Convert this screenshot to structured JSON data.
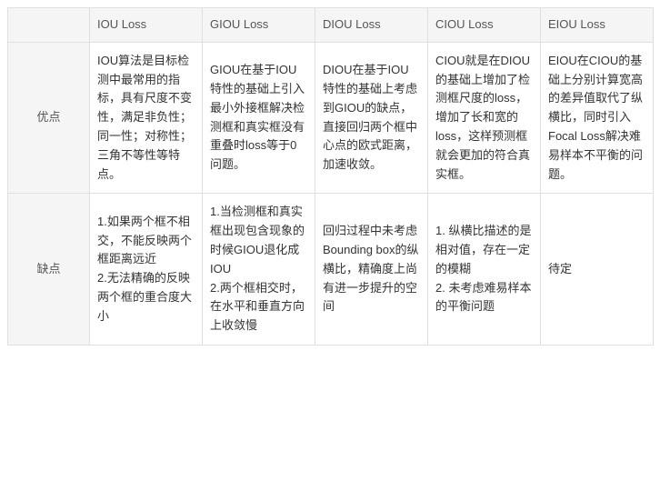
{
  "headers": {
    "empty": "",
    "iou": "IOU Loss",
    "giou": "GIOU Loss",
    "diou": "DIOU Loss",
    "ciou": "CIOU Loss",
    "eiou": "EIOU Loss"
  },
  "rows": {
    "advantages": {
      "label": "优点",
      "iou": "IOU算法是目标检测中最常用的指标，具有尺度不变性，满足非负性；同一性；对称性；三角不等性等特点。",
      "giou": "GIOU在基于IOU特性的基础上引入最小外接框解决检测框和真实框没有重叠时loss等于0问题。",
      "diou": "DIOU在基于IOU特性的基础上考虑到GIOU的缺点，直接回归两个框中心点的欧式距离，加速收敛。",
      "ciou": "CIOU就是在DIOU的基础上增加了检测框尺度的loss，增加了长和宽的loss，这样预测框就会更加的符合真实框。",
      "eiou": "EIOU在CIOU的基础上分别计算宽高的差异值取代了纵横比，同时引入Focal Loss解决难易样本不平衡的问题。"
    },
    "disadvantages": {
      "label": "缺点",
      "iou": "1.如果两个框不相交，不能反映两个框距离远近\n2.无法精确的反映两个框的重合度大小",
      "giou": "1.当检测框和真实框出现包含现象的时候GIOU退化成IOU\n2.两个框相交时，在水平和垂直方向上收敛慢",
      "diou": "回归过程中未考虑Bounding box的纵横比，精确度上尚有进一步提升的空间",
      "ciou": "1. 纵横比描述的是相对值，存在一定的模糊\n2. 未考虑难易样本的平衡问题",
      "eiou": "待定"
    }
  },
  "chart_data": {
    "type": "table",
    "title": "IOU Loss Variants Comparison",
    "columns": [
      "",
      "IOU Loss",
      "GIOU Loss",
      "DIOU Loss",
      "CIOU Loss",
      "EIOU Loss"
    ],
    "rows": [
      {
        "label": "优点",
        "values": [
          "IOU算法是目标检测中最常用的指标，具有尺度不变性，满足非负性；同一性；对称性；三角不等性等特点。",
          "GIOU在基于IOU特性的基础上引入最小外接框解决检测框和真实框没有重叠时loss等于0问题。",
          "DIOU在基于IOU特性的基础上考虑到GIOU的缺点，直接回归两个框中心点的欧式距离，加速收敛。",
          "CIOU就是在DIOU的基础上增加了检测框尺度的loss，增加了长和宽的loss，这样预测框就会更加的符合真实框。",
          "EIOU在CIOU的基础上分别计算宽高的差异值取代了纵横比，同时引入Focal Loss解决难易样本不平衡的问题。"
        ]
      },
      {
        "label": "缺点",
        "values": [
          "1.如果两个框不相交，不能反映两个框距离远近 2.无法精确的反映两个框的重合度大小",
          "1.当检测框和真实框出现包含现象的时候GIOU退化成IOU 2.两个框相交时，在水平和垂直方向上收敛慢",
          "回归过程中未考虑Bounding box的纵横比，精确度上尚有进一步提升的空间",
          "1. 纵横比描述的是相对值，存在一定的模糊 2. 未考虑难易样本的平衡问题",
          "待定"
        ]
      }
    ]
  }
}
